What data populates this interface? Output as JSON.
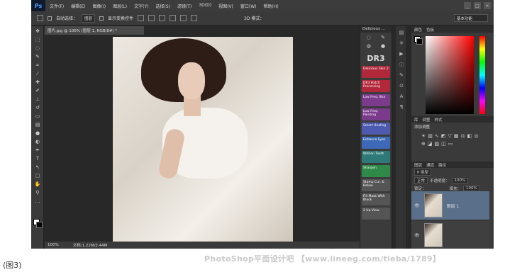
{
  "menubar": {
    "logo": "Ps",
    "items": [
      "文件(F)",
      "编辑(E)",
      "图像(I)",
      "图层(L)",
      "文字(Y)",
      "选择(S)",
      "滤镜(T)",
      "3D(D)",
      "视图(V)",
      "窗口(W)",
      "帮助(H)"
    ],
    "window_controls": [
      "_",
      "□",
      "×"
    ]
  },
  "options_bar": {
    "auto_select_label": "自动选择：",
    "auto_select_value": "图层",
    "show_transform_label": "显示变换控件",
    "mode_3d_label": "3D 模式：",
    "workspace": "基本功能"
  },
  "document": {
    "tab_title": "图片.jpg @ 100% (图层 1, RGB/8#) *",
    "zoom": "100%",
    "doc_size": "文档:1.22M/2.44M"
  },
  "plugin_panel": {
    "title": "Delicious ...",
    "logo": "DR3",
    "buttons": [
      {
        "label": "Delicious Skin 2",
        "color": "#b0283a"
      },
      {
        "label": "DR3 Batch Processing",
        "color": "#b0283a"
      },
      {
        "label": "Low Freq. Blur",
        "color": "#7b3a8c"
      },
      {
        "label": "Low Freq. Painting",
        "color": "#7b3a8c"
      },
      {
        "label": "Smart Healing",
        "color": "#4d5ab0"
      },
      {
        "label": "Enhance Eyes",
        "color": "#3c6ab8"
      },
      {
        "label": "Whiten Teeth",
        "color": "#2e7a78"
      },
      {
        "label": "Sharpen",
        "color": "#2f8a4a"
      },
      {
        "label": "Stamp Cur. & Below",
        "color": "#555555"
      },
      {
        "label": "Fill Mask With Black",
        "color": "#555555"
      },
      {
        "label": "2 Up View",
        "color": "#555555"
      }
    ]
  },
  "color_panel": {
    "tabs": [
      "颜色",
      "色板"
    ]
  },
  "adjust_panel": {
    "tabs": [
      "库",
      "调整",
      "样式"
    ],
    "title": "添加调整"
  },
  "layers_panel": {
    "tabs": [
      "图层",
      "通道",
      "路径"
    ],
    "kind": "P 类型",
    "blend_mode": "正常",
    "opacity_label": "不透明度：",
    "opacity": "100%",
    "lock_label": "锁定：",
    "fill_label": "填充：",
    "fill": "100%",
    "layer1_name": "图层 1"
  },
  "caption": "(图3)",
  "watermark": "PhotoShop平面设计吧 【www.lineeg.com/tieba/1789】"
}
